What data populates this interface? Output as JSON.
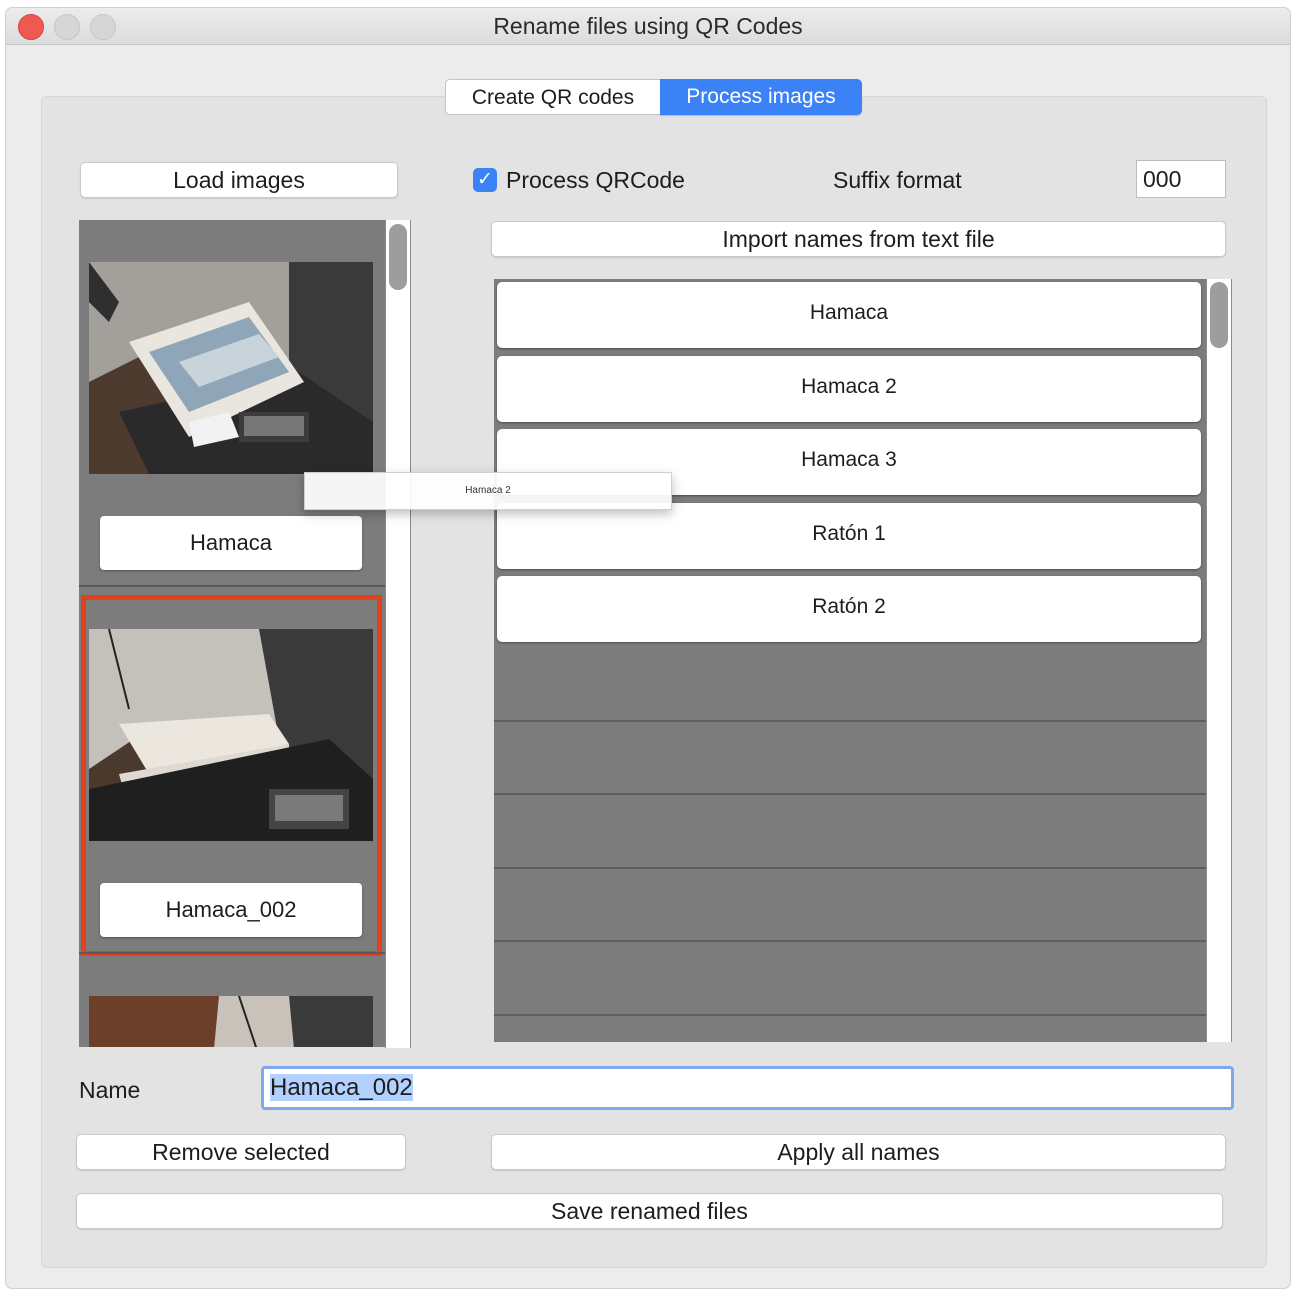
{
  "window": {
    "title": "Rename files using QR Codes"
  },
  "tabs": [
    {
      "label": "Create QR codes",
      "selected": false
    },
    {
      "label": "Process images",
      "selected": true
    }
  ],
  "toolbar": {
    "load_images": "Load images",
    "process_qrcode_label": "Process QRCode",
    "process_qrcode_checked": true,
    "suffix_format_label": "Suffix format",
    "suffix_format_value": "000",
    "import_names": "Import names from text file"
  },
  "thumbnails": [
    {
      "name": "Hamaca",
      "selected": false
    },
    {
      "name": "Hamaca_002",
      "selected": true
    }
  ],
  "names_list": [
    "Hamaca",
    "Hamaca 2",
    "Hamaca 3",
    "Ratón 1",
    "Ratón 2"
  ],
  "drag_ghost": "Hamaca 2",
  "bottom": {
    "name_label": "Name",
    "name_value": "Hamaca_002",
    "remove_selected": "Remove selected",
    "apply_all_names": "Apply all names",
    "save_renamed_files": "Save renamed files"
  },
  "colors": {
    "accent": "#3b82f6",
    "selection_border": "#e2401f",
    "list_bg": "#7c7c7c"
  }
}
